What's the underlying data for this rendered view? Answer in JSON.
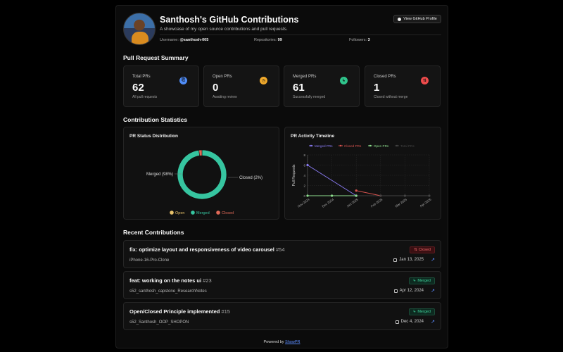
{
  "header": {
    "title": "Santhosh's GitHub Contributions",
    "subtitle": "A showcase of my open source contributions and pull requests.",
    "profile_button": "View GitHub Profile",
    "username_label": "Username:",
    "username": "@santhosh-005",
    "repos_label": "Repositories:",
    "repos": "99",
    "followers_label": "Followers:",
    "followers": "3"
  },
  "pr_summary": {
    "title": "Pull Request Summary",
    "cards": [
      {
        "label": "Total PRs",
        "value": "62",
        "sub": "All pull requests",
        "icon": "pr-icon",
        "color": "#4f8cf7"
      },
      {
        "label": "Open PRs",
        "value": "0",
        "sub": "Awaiting review",
        "icon": "clock-icon",
        "color": "#f0a92b"
      },
      {
        "label": "Merged PRs",
        "value": "61",
        "sub": "Successfully merged",
        "icon": "merge-icon",
        "color": "#2fc58c"
      },
      {
        "label": "Closed PRs",
        "value": "1",
        "sub": "Closed without merge",
        "icon": "closed-pr-icon",
        "color": "#ee4b4b"
      }
    ]
  },
  "stats": {
    "title": "Contribution Statistics",
    "donut_title": "PR Status Distribution",
    "timeline_title": "PR Activity Timeline"
  },
  "chart_data": [
    {
      "type": "pie",
      "title": "PR Status Distribution",
      "labels": [
        "Open",
        "Merged",
        "Closed"
      ],
      "values": [
        0,
        98,
        2
      ],
      "colors": [
        "#e8c26a",
        "#36c5a0",
        "#e26a58"
      ],
      "annotations": [
        "Merged (98%)",
        "Closed (2%)"
      ],
      "legend": "bottom"
    },
    {
      "type": "line",
      "title": "PR Activity Timeline",
      "categories": [
        "Nov 2024",
        "Dec 2024",
        "Jan 2025",
        "Feb 2025",
        "Mar 2025",
        "Apr 2025"
      ],
      "ylabel": "Pull Requests",
      "ylim": [
        0,
        8
      ],
      "yticks": [
        0,
        2,
        4,
        6,
        8
      ],
      "legend": "top",
      "series": [
        {
          "name": "Merged PRs",
          "color": "#8b7cf6",
          "values": [
            6,
            null,
            0,
            null,
            null,
            null
          ]
        },
        {
          "name": "Closed PRs",
          "color": "#d9534f",
          "values": [
            null,
            null,
            1,
            0,
            null,
            null
          ]
        },
        {
          "name": "Open PRs",
          "color": "#8fe08f",
          "values": [
            0,
            0,
            0,
            null,
            null,
            null
          ]
        },
        {
          "name": "Total PRs",
          "color": "#444444",
          "values": [
            null,
            null,
            null,
            0,
            0,
            0
          ]
        }
      ]
    }
  ],
  "recent": {
    "title": "Recent Contributions",
    "items": [
      {
        "title": "fix: optimize layout and responsiveness of video carousel",
        "number": "#54",
        "repo": "iPhone-16-Pro-Clone",
        "status": "Closed",
        "date": "Jan 13, 2025"
      },
      {
        "title": "feat: working on the notes ui",
        "number": "#23",
        "repo": "s52_santhosh_capstone_ResearchNotes",
        "status": "Merged",
        "date": "Apr 12, 2024"
      },
      {
        "title": "Open/Closed Principle implemented",
        "number": "#15",
        "repo": "s52_Santhosh_OOP_SHOPON",
        "status": "Merged",
        "date": "Dec 4, 2024"
      }
    ]
  },
  "footer": {
    "prefix": "Powered by",
    "link": "ShowPR"
  }
}
